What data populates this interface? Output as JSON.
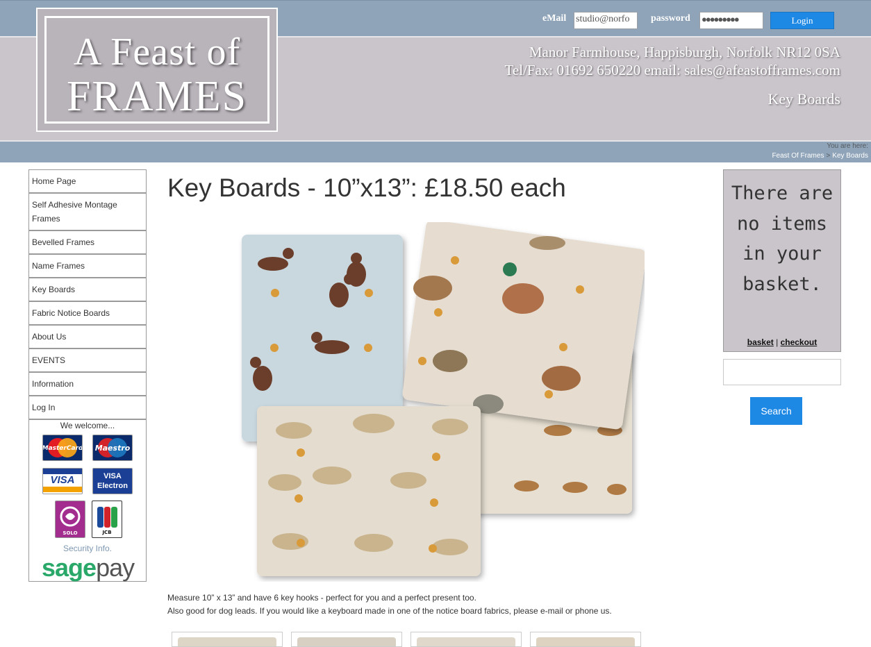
{
  "logo": {
    "line1": "A Feast of",
    "line2": "FRAMES"
  },
  "login": {
    "email_label": "eMail",
    "email_value": "studio@norfo",
    "password_label": "password",
    "password_value": "●●●●●●●●●",
    "button": "Login"
  },
  "header": {
    "address": "Manor Farmhouse, Happisburgh, Norfolk NR12 0SA",
    "contact": "Tel/Fax: 01692 650220 email: sales@afeastofframes.com",
    "page_name": "Key Boards"
  },
  "breadcrumb": {
    "prefix": "You are here:",
    "items": [
      "Feast Of Frames",
      "Key Boards"
    ],
    "separator": ">"
  },
  "nav": {
    "items": [
      {
        "label": "Home Page"
      },
      {
        "label": "Self Adhesive Montage Frames"
      },
      {
        "label": "Bevelled Frames"
      },
      {
        "label": "Name Frames"
      },
      {
        "label": "Key Boards"
      },
      {
        "label": "Fabric Notice Boards"
      },
      {
        "label": "About Us"
      },
      {
        "label": "EVENTS"
      },
      {
        "label": "Information"
      },
      {
        "label": "Log In"
      }
    ],
    "welcome_title": "We welcome...",
    "cards": [
      "MasterCard",
      "Maestro",
      "VISA",
      "VISA Electron",
      "SOLO",
      "JCB"
    ],
    "security_link": "Security Info.",
    "sagepay": {
      "part1": "sage",
      "part2": "pay"
    }
  },
  "main": {
    "title": "Key Boards - 10”x13”: £18.50 each",
    "description_line1": "Measure 10” x 13” and have 6 key hooks - perfect for you and a perfect present too.",
    "description_line2": "Also good for dog leads. If you would like a keyboard made in one of the notice board fabrics, please e-mail or phone us."
  },
  "basket": {
    "message": "There are no items in your basket.",
    "basket_link": "basket",
    "separator": "|",
    "checkout_link": "checkout"
  },
  "search": {
    "button": "Search",
    "placeholder": ""
  },
  "colors": {
    "header_band": "#8fa4b8",
    "header_main": "#cac5cb",
    "accent_button": "#1e88e5"
  }
}
